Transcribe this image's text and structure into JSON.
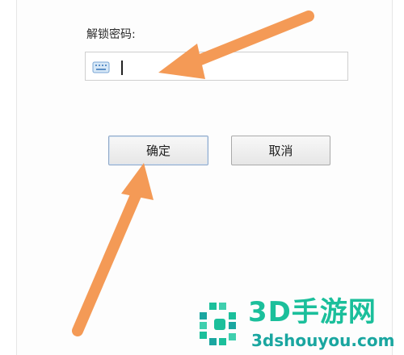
{
  "dialog": {
    "field_label": "解锁密码:",
    "password_value": "",
    "ok_label": "确定",
    "cancel_label": "取消"
  },
  "watermark": {
    "brand": "3D手游网",
    "url": "3dshouyou.com"
  },
  "colors": {
    "arrow": "#f49a56",
    "watermark_primary": "#1bbf9b",
    "watermark_secondary": "#1aa6a0"
  },
  "icons": {
    "input_icon": "keyboard-icon"
  }
}
